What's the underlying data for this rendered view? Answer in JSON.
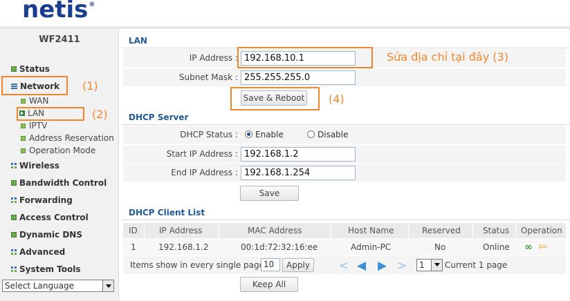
{
  "header": {
    "logo": "netis",
    "logo_mark": "®"
  },
  "sidebar": {
    "model": "WF2411",
    "items": [
      {
        "label": "Status",
        "icon": "green-square-icon"
      },
      {
        "label": "Network",
        "icon": "lines-icon"
      },
      {
        "label": "WAN",
        "icon": "green-dot-icon"
      },
      {
        "label": "LAN",
        "icon": "play-arrow-icon"
      },
      {
        "label": "IPTV",
        "icon": "green-dot-icon"
      },
      {
        "label": "Address Reservation",
        "icon": "green-dot-icon"
      },
      {
        "label": "Operation Mode",
        "icon": "green-dot-icon"
      },
      {
        "label": "Wireless",
        "icon": "grid-icon"
      },
      {
        "label": "Bandwidth Control",
        "icon": "green-square-icon"
      },
      {
        "label": "Forwarding",
        "icon": "grid-icon"
      },
      {
        "label": "Access Control",
        "icon": "green-square-icon"
      },
      {
        "label": "Dynamic DNS",
        "icon": "green-square-icon"
      },
      {
        "label": "Advanced",
        "icon": "grid-icon"
      },
      {
        "label": "System Tools",
        "icon": "grid-icon"
      }
    ],
    "language": "Select Language"
  },
  "annotations": {
    "network": "(1)",
    "lan": "(2)",
    "ip_hint": "Sửa địa chỉ tại đây (3)",
    "save": "(4)"
  },
  "lan": {
    "title": "LAN",
    "ip_label": "IP Address :",
    "ip_value": "192.168.10.1",
    "mask_label": "Subnet Mask :",
    "mask_value": "255.255.255.0",
    "save_reboot": "Save & Reboot"
  },
  "dhcp": {
    "title": "DHCP Server",
    "status_label": "DHCP Status :",
    "enable": "Enable",
    "disable": "Disable",
    "status_selected": "Enable",
    "start_label": "Start IP Address :",
    "start_value": "192.168.1.2",
    "end_label": "End IP Address :",
    "end_value": "192.168.1.254",
    "save": "Save"
  },
  "clients": {
    "title": "DHCP Client List",
    "columns": [
      "ID",
      "IP Address",
      "MAC Address",
      "Host Name",
      "Reserved",
      "Status",
      "Operation"
    ],
    "rows": [
      {
        "id": "1",
        "ip": "192.168.1.2",
        "mac": "00:1d:72:32:16:ee",
        "host": "Admin-PC",
        "reserved": "No",
        "status": "Online"
      }
    ],
    "items_label": "Items show in every single page",
    "items_value": "10",
    "apply": "Apply",
    "page_value": "1",
    "current_page": "Current 1 page",
    "keep_all": "Keep All"
  },
  "colors": {
    "accent": "#f0862a",
    "title_blue": "#1f5a99",
    "logo_blue": "#1a3d8f"
  }
}
